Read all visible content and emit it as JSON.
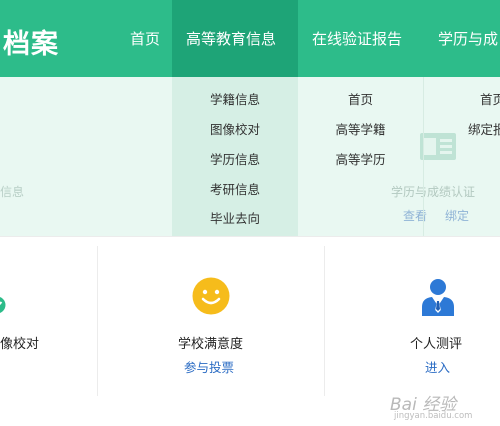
{
  "header": {
    "brand": "档案",
    "nav": [
      "首页",
      "高等教育信息",
      "在线验证报告",
      "学历与成"
    ]
  },
  "dropdown": {
    "col1": [
      "学籍信息",
      "图像校对",
      "学历信息",
      "考研信息",
      "毕业去向"
    ],
    "col2": [
      "首页",
      "高等学籍",
      "高等学历"
    ],
    "col3": [
      "首页",
      "绑定报"
    ]
  },
  "background": {
    "left_label": "信息",
    "right_title": "学历与成绩认证",
    "right_link_view": "查看",
    "right_link_bind": "绑定"
  },
  "cards": [
    {
      "title": "像校对",
      "link": "",
      "icon": "check-circle-icon"
    },
    {
      "title": "学校满意度",
      "link": "参与投票",
      "icon": "smiley-face-icon"
    },
    {
      "title": "个人测评",
      "link": "进入",
      "icon": "person-suit-icon"
    }
  ],
  "watermark": {
    "main": "Bai 经验",
    "sub": "jingyan.baidu.com"
  },
  "colors": {
    "header_green": "#2dbc8a",
    "header_active": "#1ea477",
    "dropdown_bg": "#e9f8f2",
    "link_blue": "#2b6cc4",
    "smiley_yellow": "#f6bc1b",
    "person_blue": "#2d79d6"
  }
}
